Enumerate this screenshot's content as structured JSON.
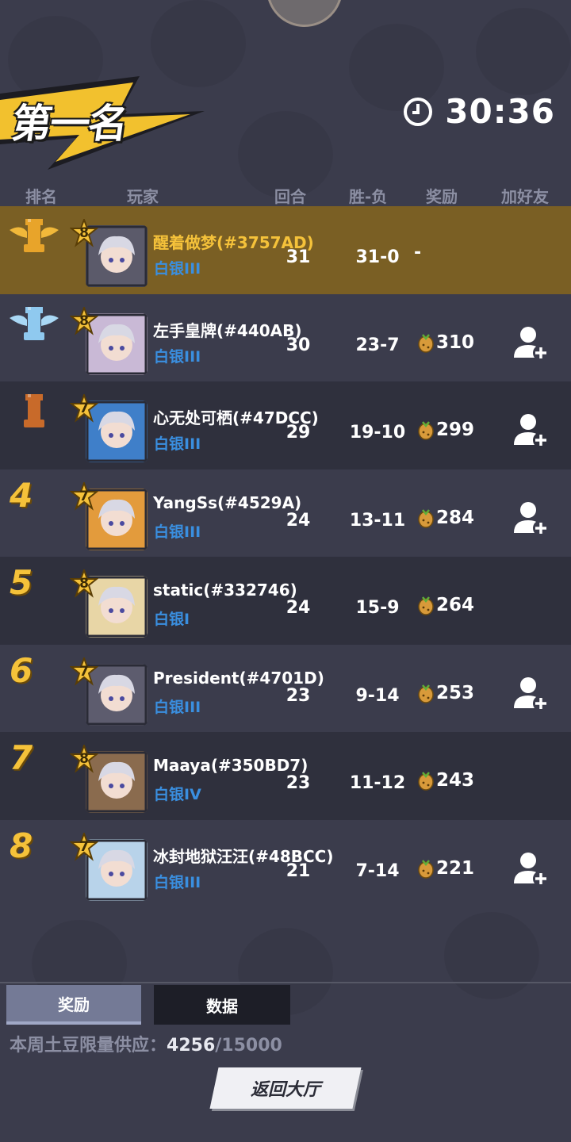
{
  "header": {
    "placement_label": "第一名",
    "timer": "30:36"
  },
  "columns": {
    "rank": "排名",
    "player": "玩家",
    "rounds": "回合",
    "record": "胜-负",
    "reward": "奖励",
    "add_friend": "加好友"
  },
  "colors": {
    "accent_gold": "#f5c23a",
    "tier_blue": "#3a8fe0",
    "highlight_row": "#7a5f24"
  },
  "players": [
    {
      "rank": "1",
      "rank_icon": "gold-rook-winged-icon",
      "level": "8",
      "name": "醒着做梦(#3757AD)",
      "tier": "白银III",
      "rounds": "31",
      "record": "31-0",
      "reward": "-",
      "add_friend": false,
      "is_self": true
    },
    {
      "rank": "2",
      "rank_icon": "silver-rook-winged-icon",
      "level": "8",
      "name": "左手皇牌(#440AB)",
      "tier": "白银III",
      "rounds": "30",
      "record": "23-7",
      "reward": "310",
      "add_friend": true,
      "is_self": false
    },
    {
      "rank": "3",
      "rank_icon": "bronze-rook-icon",
      "level": "7",
      "name": "心无处可栖(#47DCC)",
      "tier": "白银III",
      "rounds": "29",
      "record": "19-10",
      "reward": "299",
      "add_friend": true,
      "is_self": false
    },
    {
      "rank": "4",
      "rank_icon": "",
      "level": "7",
      "name": "YangSs(#4529A)",
      "tier": "白银III",
      "rounds": "24",
      "record": "13-11",
      "reward": "284",
      "add_friend": true,
      "is_self": false
    },
    {
      "rank": "5",
      "rank_icon": "",
      "level": "8",
      "name": "static(#332746)",
      "tier": "白银I",
      "rounds": "24",
      "record": "15-9",
      "reward": "264",
      "add_friend": false,
      "is_self": false
    },
    {
      "rank": "6",
      "rank_icon": "",
      "level": "7",
      "name": "President(#4701D)",
      "tier": "白银III",
      "rounds": "23",
      "record": "9-14",
      "reward": "253",
      "add_friend": true,
      "is_self": false
    },
    {
      "rank": "7",
      "rank_icon": "",
      "level": "8",
      "name": "Maaya(#350BD7)",
      "tier": "白银IV",
      "rounds": "23",
      "record": "11-12",
      "reward": "243",
      "add_friend": false,
      "is_self": false
    },
    {
      "rank": "8",
      "rank_icon": "",
      "level": "7",
      "name": "冰封地狱汪汪(#48BCC)",
      "tier": "白银III",
      "rounds": "21",
      "record": "7-14",
      "reward": "221",
      "add_friend": true,
      "is_self": false
    }
  ],
  "tabs": {
    "reward": "奖励",
    "data": "数据"
  },
  "supply": {
    "label": "本周土豆限量供应：",
    "current": "4256",
    "max": "/15000"
  },
  "back_button": "返回大厅"
}
